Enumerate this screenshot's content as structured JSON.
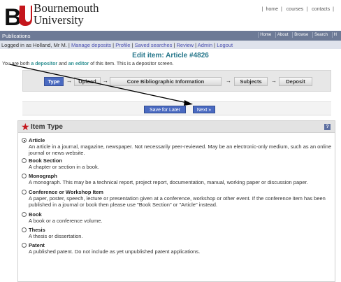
{
  "header": {
    "logo_line1": "Bournemouth",
    "logo_line2": "University",
    "toplinks": [
      "home",
      "courses",
      "contacts"
    ]
  },
  "navbar": {
    "section": "Publications",
    "links": [
      "Home",
      "About",
      "Browse",
      "Search",
      "H"
    ]
  },
  "loginbar": {
    "logged_in": "Logged in as Holland, Mr M.",
    "links": [
      "Manage deposits",
      "Profile",
      "Saved searches",
      "Review",
      "Admin",
      "Logout"
    ]
  },
  "page": {
    "title": "Edit item: Article #4826",
    "role_prefix": "You are both",
    "role_depositor": "a depositor",
    "role_mid": "and",
    "role_editor": "an editor",
    "role_suffix": "of this item. This is a depositor screen."
  },
  "stages": [
    {
      "label": "Type",
      "active": true
    },
    {
      "label": "Upload",
      "active": false
    },
    {
      "label": "Core Bibliographic Information",
      "active": false
    },
    {
      "label": "Subjects",
      "active": false
    },
    {
      "label": "Deposit",
      "active": false
    }
  ],
  "buttons": {
    "save_later": "Save for Later",
    "next": "Next »"
  },
  "panel": {
    "title": "Item Type",
    "help": "?",
    "options": [
      {
        "label": "Article",
        "checked": true,
        "desc": "An article in a journal, magazine, newspaper. Not necessarily peer-reviewed. May be an electronic-only medium, such as an online journal or news website."
      },
      {
        "label": "Book Section",
        "checked": false,
        "desc": "A chapter or section in a book."
      },
      {
        "label": "Monograph",
        "checked": false,
        "desc": "A monograph. This may be a technical report, project report, documentation, manual, working paper or discussion paper."
      },
      {
        "label": "Conference or Workshop Item",
        "checked": false,
        "desc": "A paper, poster, speech, lecture or presentation given at a conference, workshop or other event. If the conference item has been published in a journal or book then please use \"Book Section\" or \"Article\" instead."
      },
      {
        "label": "Book",
        "checked": false,
        "desc": "A book or a conference volume."
      },
      {
        "label": "Thesis",
        "checked": false,
        "desc": "A thesis or dissertation."
      },
      {
        "label": "Patent",
        "checked": false,
        "desc": "A published patent. Do not include as yet unpublished patent applications."
      }
    ]
  }
}
